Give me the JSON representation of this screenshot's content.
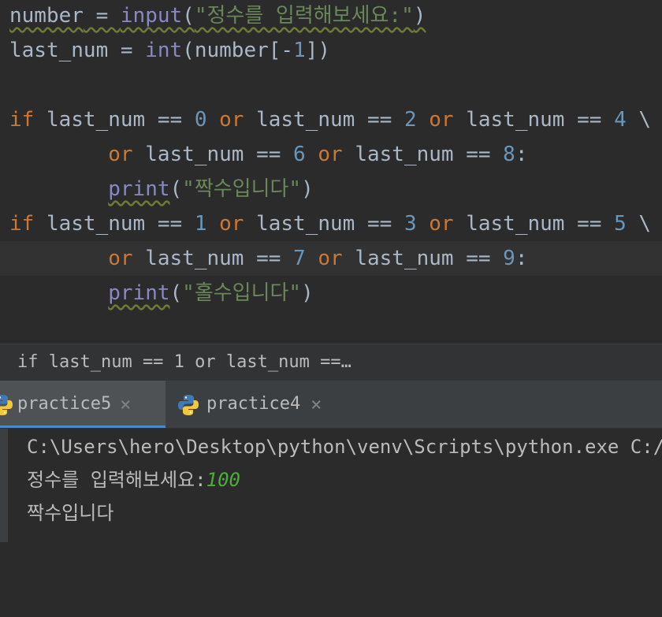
{
  "editor": {
    "lines": [
      {
        "segs": [
          {
            "t": "number",
            "c": "plain"
          },
          {
            "t": " = ",
            "c": "plain"
          },
          {
            "t": "input",
            "c": "builtin"
          },
          {
            "t": "(",
            "c": "plain"
          },
          {
            "t": "\"정수를 입력해보세요:\"",
            "c": "str"
          },
          {
            "t": ")",
            "c": "plain"
          }
        ],
        "squiggle_from_start": true
      },
      {
        "segs": [
          {
            "t": "last_num",
            "c": "plain"
          },
          {
            "t": " = ",
            "c": "plain"
          },
          {
            "t": "int",
            "c": "builtin"
          },
          {
            "t": "(number[-",
            "c": "plain"
          },
          {
            "t": "1",
            "c": "num"
          },
          {
            "t": "])",
            "c": "plain"
          }
        ]
      },
      {
        "segs": []
      },
      {
        "segs": [
          {
            "t": "if",
            "c": "kw"
          },
          {
            "t": " last_num == ",
            "c": "plain"
          },
          {
            "t": "0",
            "c": "num"
          },
          {
            "t": " or",
            "c": "kw"
          },
          {
            "t": " last_num == ",
            "c": "plain"
          },
          {
            "t": "2",
            "c": "num"
          },
          {
            "t": " or",
            "c": "kw"
          },
          {
            "t": " last_num == ",
            "c": "plain"
          },
          {
            "t": "4",
            "c": "num"
          },
          {
            "t": " \\",
            "c": "plain"
          }
        ]
      },
      {
        "segs": [
          {
            "t": "        ",
            "c": "plain"
          },
          {
            "t": "or",
            "c": "kw"
          },
          {
            "t": " last_num == ",
            "c": "plain"
          },
          {
            "t": "6",
            "c": "num"
          },
          {
            "t": " or",
            "c": "kw"
          },
          {
            "t": " last_num == ",
            "c": "plain"
          },
          {
            "t": "8",
            "c": "num"
          },
          {
            "t": ":",
            "c": "plain"
          }
        ]
      },
      {
        "segs": [
          {
            "t": "        ",
            "c": "plain"
          },
          {
            "t": "print",
            "c": "builtin squiggle"
          },
          {
            "t": "(",
            "c": "plain"
          },
          {
            "t": "\"짝수입니다\"",
            "c": "str"
          },
          {
            "t": ")",
            "c": "plain"
          }
        ]
      },
      {
        "segs": [
          {
            "t": "if",
            "c": "kw"
          },
          {
            "t": " last_num == ",
            "c": "plain"
          },
          {
            "t": "1",
            "c": "num"
          },
          {
            "t": " or",
            "c": "kw"
          },
          {
            "t": " last_num == ",
            "c": "plain"
          },
          {
            "t": "3",
            "c": "num"
          },
          {
            "t": " or",
            "c": "kw"
          },
          {
            "t": " last_num == ",
            "c": "plain"
          },
          {
            "t": "5",
            "c": "num"
          },
          {
            "t": " \\",
            "c": "plain"
          }
        ]
      },
      {
        "segs": [
          {
            "t": "        ",
            "c": "plain"
          },
          {
            "t": "or",
            "c": "kw"
          },
          {
            "t": " last_num == ",
            "c": "plain"
          },
          {
            "t": "7",
            "c": "num"
          },
          {
            "t": " or",
            "c": "kw"
          },
          {
            "t": " last_num == ",
            "c": "plain"
          },
          {
            "t": "9",
            "c": "num"
          },
          {
            "t": ":",
            "c": "plain"
          }
        ],
        "current": true
      },
      {
        "segs": [
          {
            "t": "        ",
            "c": "plain"
          },
          {
            "t": "print",
            "c": "builtin squiggle"
          },
          {
            "t": "(",
            "c": "plain"
          },
          {
            "t": "\"홀수입니다\"",
            "c": "str"
          },
          {
            "t": ")",
            "c": "plain"
          }
        ]
      }
    ]
  },
  "breadcrumb": {
    "text": "if last_num == 1 or last_num ==…"
  },
  "tabs": [
    {
      "label": "practice5",
      "close": "×",
      "active": true
    },
    {
      "label": "practice4",
      "close": "×",
      "active": false
    }
  ],
  "console": {
    "command": "C:\\Users\\hero\\Desktop\\python\\venv\\Scripts\\python.exe C:/Us",
    "prompt": "정수를 입력해보세요:",
    "user_input": "100",
    "output": "짝수입니다"
  },
  "colors": {
    "keyword": "#cc7832",
    "number": "#6897bb",
    "string": "#6a8759",
    "builtin": "#8888c6",
    "text": "#a9b7c6",
    "console_input": "#4cad3b"
  }
}
